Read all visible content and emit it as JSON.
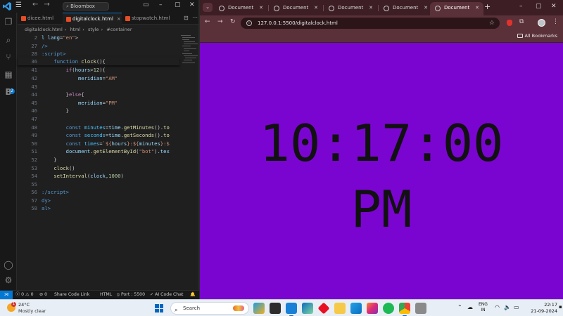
{
  "vscode": {
    "search_text": "Bloombox",
    "tabs": [
      {
        "label": "dicee.html"
      },
      {
        "label": "digitalclock.html",
        "close": "×"
      },
      {
        "label": "stopwatch.html"
      }
    ],
    "breadcrumb": [
      "digitalclock.html",
      "html",
      "style",
      "#container"
    ],
    "code_lines": [
      {
        "n": "2",
        "html": "<span class='vr'>l lang</span>=<span class='st'>\"en\"</span>&gt;"
      },
      {
        "n": "27",
        "html": "<span class='tg'>/&gt;</span>"
      },
      {
        "n": "28",
        "html": "<span class='tg'>:script&gt;</span>"
      },
      {
        "n": "36",
        "html": "    <span class='kw'>function</span> <span class='fn'>clock</span>(){"
      },
      {
        "n": "41",
        "html": "        <span class='pk'>if</span>(<span class='vr'>hours</span>&gt;<span class='nu'>12</span>){"
      },
      {
        "n": "42",
        "html": "            <span class='vr'>meridian</span>=<span class='st'>\"AM\"</span>"
      },
      {
        "n": "43",
        "html": ""
      },
      {
        "n": "44",
        "html": "        }<span class='pk'>else</span>{"
      },
      {
        "n": "45",
        "html": "            <span class='vr'>meridian</span>=<span class='st'>\"PM\"</span>"
      },
      {
        "n": "46",
        "html": "        }"
      },
      {
        "n": "47",
        "html": ""
      },
      {
        "n": "48",
        "html": "        <span class='kw'>const</span> <span class='ct'>minutes</span>=<span class='vr'>time</span>.<span class='fn'>getMinutes</span>().<span class='fn'>to</span>"
      },
      {
        "n": "49",
        "html": "        <span class='kw'>const</span> <span class='ct'>seconds</span>=<span class='vr'>time</span>.<span class='fn'>getSeconds</span>().<span class='fn'>to</span>"
      },
      {
        "n": "50",
        "html": "        <span class='kw'>const</span> <span class='ct'>times</span>=<span class='st'>`${</span><span class='vr'>hours</span><span class='st'>}:${</span><span class='vr'>minutes</span><span class='st'>}:$</span>"
      },
      {
        "n": "51",
        "html": "        <span class='vr'>document</span>.<span class='fn'>getElementById</span>(<span class='st'>\"bot\"</span>).<span class='vr'>tex</span>"
      },
      {
        "n": "52",
        "html": "    }"
      },
      {
        "n": "53",
        "html": "    <span class='fn'>clock</span>()"
      },
      {
        "n": "54",
        "html": "    <span class='fn'>setInterval</span>(<span class='vr'>clock</span>,<span class='nu'>1000</span>)"
      },
      {
        "n": "55",
        "html": ""
      },
      {
        "n": "56",
        "html": "<span class='tg'>:/script&gt;</span>"
      },
      {
        "n": "57",
        "html": "<span class='tg'>dy&gt;</span>"
      },
      {
        "n": "58",
        "html": "<span class='tg'>al&gt;</span>"
      }
    ],
    "status": {
      "errors": "0",
      "warnings": "0",
      "ports": "0",
      "share": "Share Code Link",
      "language": "HTML",
      "port": "Port : 5500",
      "ai": "AI Code Chat"
    }
  },
  "chrome": {
    "tabs": [
      {
        "label": "Document"
      },
      {
        "label": "Document"
      },
      {
        "label": "Document"
      },
      {
        "label": "Document"
      },
      {
        "label": "Document"
      }
    ],
    "url": "127.0.0.1:5500/digitalclock.html",
    "all_bookmarks": "All Bookmarks",
    "page": {
      "time": "10:17:00",
      "meridian": "PM",
      "background": "#7a05d1"
    }
  },
  "taskbar": {
    "weather_badge": "1",
    "temperature": "24°C",
    "condition": "Mostly clear",
    "search_placeholder": "Search",
    "lang_1": "ENG",
    "lang_2": "IN",
    "time": "22:17",
    "date": "21-09-2024"
  }
}
